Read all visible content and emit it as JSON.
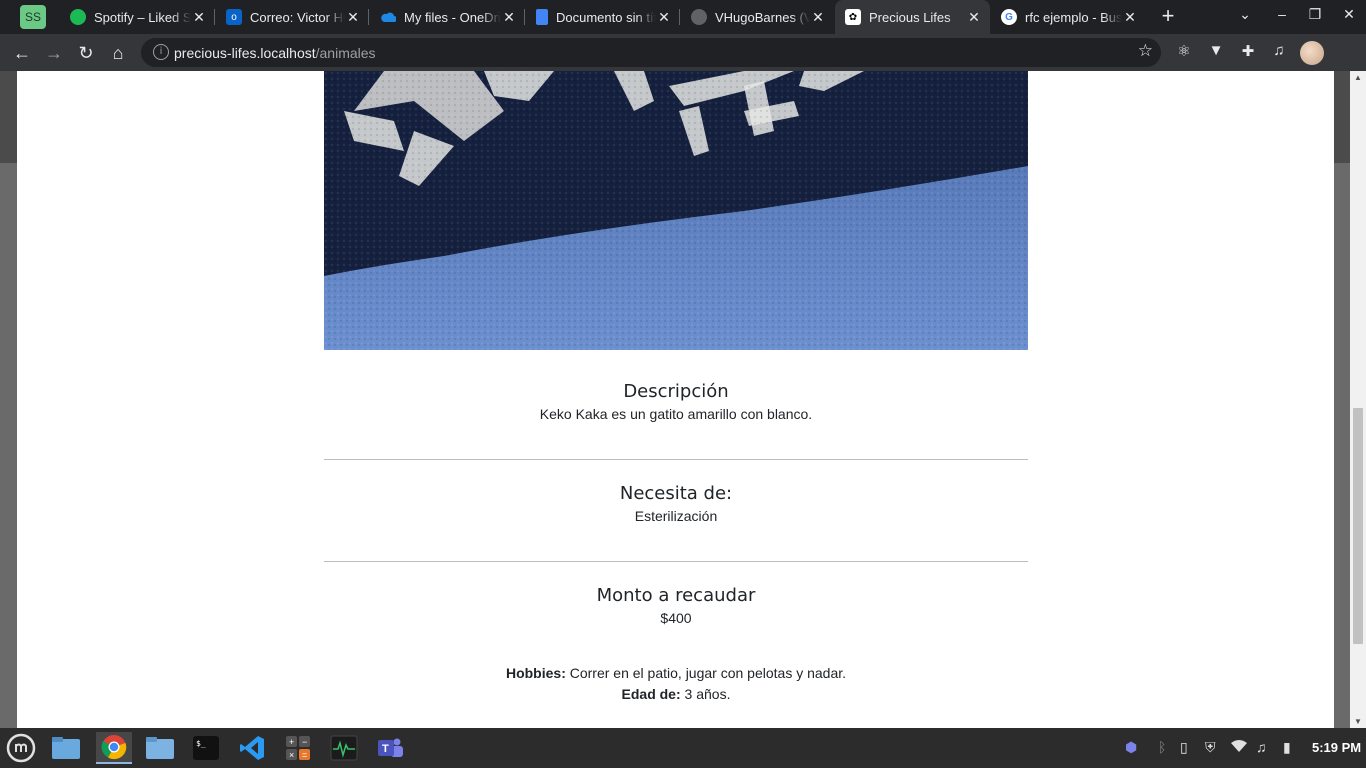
{
  "browser": {
    "profile_initials": "SS",
    "tabs": [
      {
        "title": "Spotify – Liked Songs",
        "icon": "spotify-icon",
        "color": "#1db954"
      },
      {
        "title": "Correo: Victor Hugo",
        "icon": "outlook-icon",
        "color": "#0a64c8"
      },
      {
        "title": "My files - OneDrive",
        "icon": "onedrive-icon",
        "color": "#1e88e5"
      },
      {
        "title": "Documento sin título",
        "icon": "docs-icon",
        "color": "#4285f4"
      },
      {
        "title": "VHugoBarnes (Victor)",
        "icon": "github-icon",
        "color": "#e8eaed"
      },
      {
        "title": "Precious Lifes",
        "icon": "paw-icon",
        "color": "#ffffff"
      },
      {
        "title": "rfc ejemplo - Buscar con Google",
        "icon": "google-icon",
        "color": "#4285f4"
      }
    ],
    "url_host": "precious-lifes.localhost",
    "url_path": "/animales"
  },
  "page": {
    "descripcion_title": "Descripción",
    "descripcion_text": "Keko Kaka es un gatito amarillo con blanco.",
    "necesita_title": "Necesita de:",
    "necesita_text": "Esterilización",
    "monto_title": "Monto a recaudar",
    "monto_text": "$400",
    "hobbies_label": "Hobbies:",
    "hobbies_text": " Correr en el patio, jugar con pelotas y nadar.",
    "edad_label": "Edad de:",
    "edad_text": " 3 años."
  },
  "taskbar": {
    "apps": [
      "menu-icon",
      "files-icon",
      "chrome-icon",
      "folder-icon",
      "terminal-icon",
      "vscode-icon",
      "calculator-icon",
      "system-monitor-icon",
      "teams-icon"
    ],
    "clock": "5:19 PM"
  }
}
